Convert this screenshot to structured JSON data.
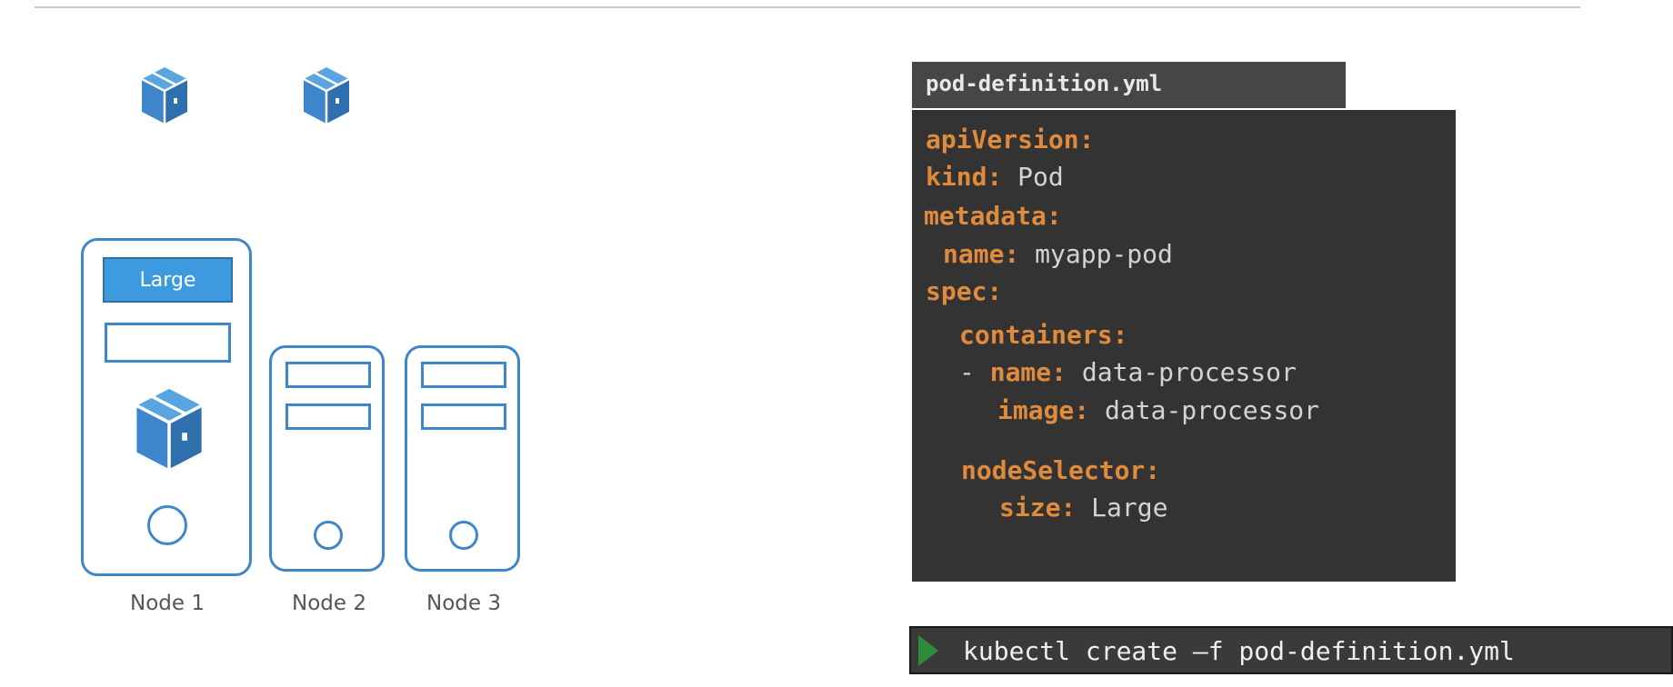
{
  "nodes": [
    {
      "label": "Node 1",
      "slot_label": "Large"
    },
    {
      "label": "Node 2"
    },
    {
      "label": "Node 3"
    }
  ],
  "file": {
    "name": "pod-definition.yml",
    "lines": {
      "l1_key": "apiVersion:",
      "l2_key": "kind:",
      "l2_val": "Pod",
      "l3_key": "metadata:",
      "l4_key": "name:",
      "l4_val": "myapp-pod",
      "l5_key": "spec:",
      "l6_key": "containers:",
      "l7_dash": "-",
      "l7_key": "name:",
      "l7_val": "data-processor",
      "l8_key": "image:",
      "l8_val": "data-processor",
      "l9_key": "nodeSelector:",
      "l10_key": "size:",
      "l10_val": "Large"
    }
  },
  "terminal": {
    "command": "kubectl create –f pod-definition.yml"
  },
  "colors": {
    "accent_blue": "#3d86cc",
    "yaml_key": "#e08a3c",
    "yaml_value": "#d4d4d4",
    "panel_bg": "#333333",
    "prompt_green": "#2f8a3a"
  },
  "icons": [
    "pod-cube-icon",
    "pod-cube-icon",
    "pod-cube-icon",
    "prompt-arrow-icon"
  ]
}
